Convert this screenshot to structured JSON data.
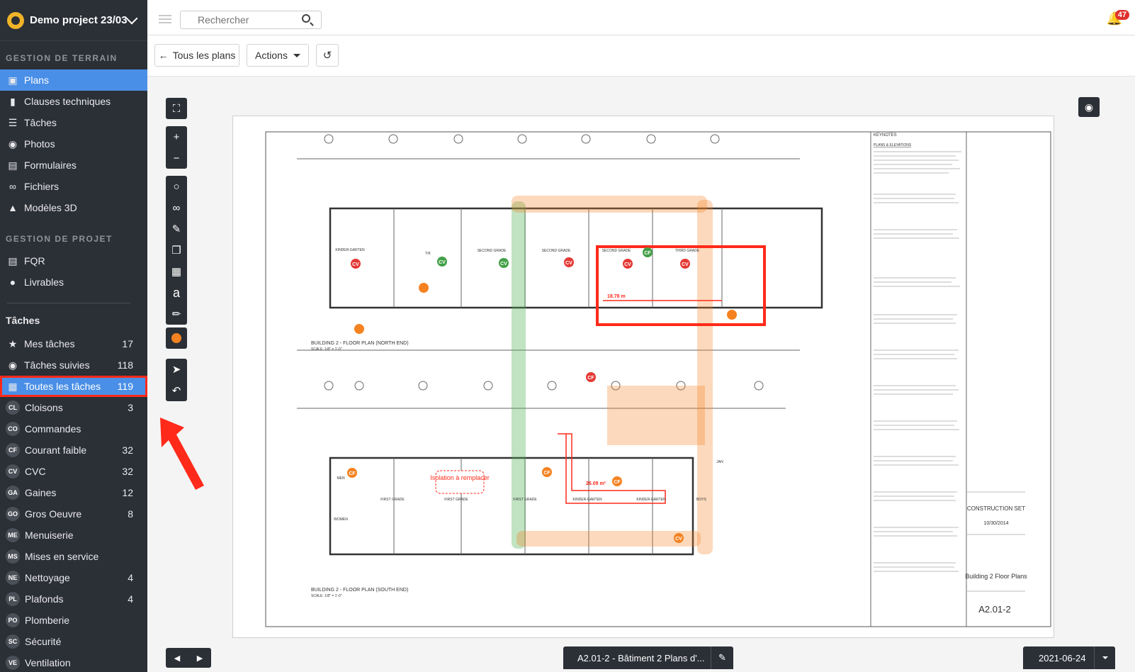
{
  "sidebar": {
    "project_name": "Demo project 23/03",
    "section_terrain": "GESTION DE TERRAIN",
    "terrain_items": [
      {
        "label": "Plans",
        "icon": "plans-icon"
      },
      {
        "label": "Clauses techniques",
        "icon": "book-icon"
      },
      {
        "label": "Tâches",
        "icon": "list-icon"
      },
      {
        "label": "Photos",
        "icon": "camera-icon"
      },
      {
        "label": "Formulaires",
        "icon": "clipboard-icon"
      },
      {
        "label": "Fichiers",
        "icon": "paperclip-icon"
      },
      {
        "label": "Modèles 3D",
        "icon": "cube-icon"
      }
    ],
    "section_projet": "GESTION DE PROJET",
    "projet_items": [
      {
        "label": "FQR",
        "icon": "document-icon"
      },
      {
        "label": "Livrables",
        "icon": "user-icon"
      }
    ],
    "taches_title": "Tâches",
    "task_items": [
      {
        "label": "Mes tâches",
        "count": "17",
        "icon": "star-icon"
      },
      {
        "label": "Tâches suivies",
        "count": "118",
        "icon": "eye-icon"
      },
      {
        "label": "Toutes les tâches",
        "count": "119",
        "icon": "grid-icon"
      }
    ],
    "categories": [
      {
        "abbr": "CL",
        "label": "Cloisons",
        "count": "3"
      },
      {
        "abbr": "CO",
        "label": "Commandes",
        "count": ""
      },
      {
        "abbr": "CF",
        "label": "Courant faible",
        "count": "32"
      },
      {
        "abbr": "CV",
        "label": "CVC",
        "count": "32"
      },
      {
        "abbr": "GA",
        "label": "Gaines",
        "count": "12"
      },
      {
        "abbr": "GO",
        "label": "Gros Oeuvre",
        "count": "8"
      },
      {
        "abbr": "ME",
        "label": "Menuiserie",
        "count": ""
      },
      {
        "abbr": "MS",
        "label": "Mises en service",
        "count": ""
      },
      {
        "abbr": "NE",
        "label": "Nettoyage",
        "count": "4"
      },
      {
        "abbr": "PL",
        "label": "Plafonds",
        "count": "4"
      },
      {
        "abbr": "PO",
        "label": "Plomberie",
        "count": ""
      },
      {
        "abbr": "SC",
        "label": "Sécurité",
        "count": ""
      },
      {
        "abbr": "VE",
        "label": "Ventilation",
        "count": ""
      }
    ]
  },
  "topbar": {
    "search_placeholder": "Rechercher",
    "notification_count": "47"
  },
  "toolbar": {
    "back_label": "Tous les plans",
    "actions_label": "Actions"
  },
  "plan": {
    "name": "A2.01-2 - Bâtiment 2 Plans d'...",
    "date": "2021-06-24",
    "north_title": "BUILDING 2 - FLOOR PLAN (NORTH END)",
    "south_title": "BUILDING 2 - FLOOR PLAN (SOUTH END)",
    "scale": "SCALE: 1/8\" = 1'-0\"",
    "keynotes_title": "KEYNOTES",
    "keynotes_sub": "PLANS & ELEVATIONS",
    "construction": "CONSTRUCTION SET",
    "construction_date": "10/30/2014",
    "sheet_title": "Building 2 Floor Plans",
    "sheet_number": "A2.01-2",
    "measure_1": "18.78 m",
    "measure_2": "26.09 m²",
    "annotation": "Isolation à remplacer",
    "rooms": [
      "KINDER-GARTEN",
      "T/K",
      "SECOND GRADE",
      "SECOND GRADE",
      "SECOND GRADE",
      "THIRD GRADE",
      "FIRST GRADE",
      "FIRST GRADE",
      "FIRST GRADE",
      "KINDER-GARTEN",
      "KINDER-GARTEN",
      "BOYS",
      "JAN",
      "MEN",
      "WOMEN"
    ]
  },
  "colors": {
    "sidebar_bg": "#2b2f36",
    "accent": "#4a8fe7",
    "highlight_red": "#ff2a1a",
    "pin_red": "#e53935",
    "pin_green": "#43a047",
    "pin_orange": "#f58220"
  }
}
